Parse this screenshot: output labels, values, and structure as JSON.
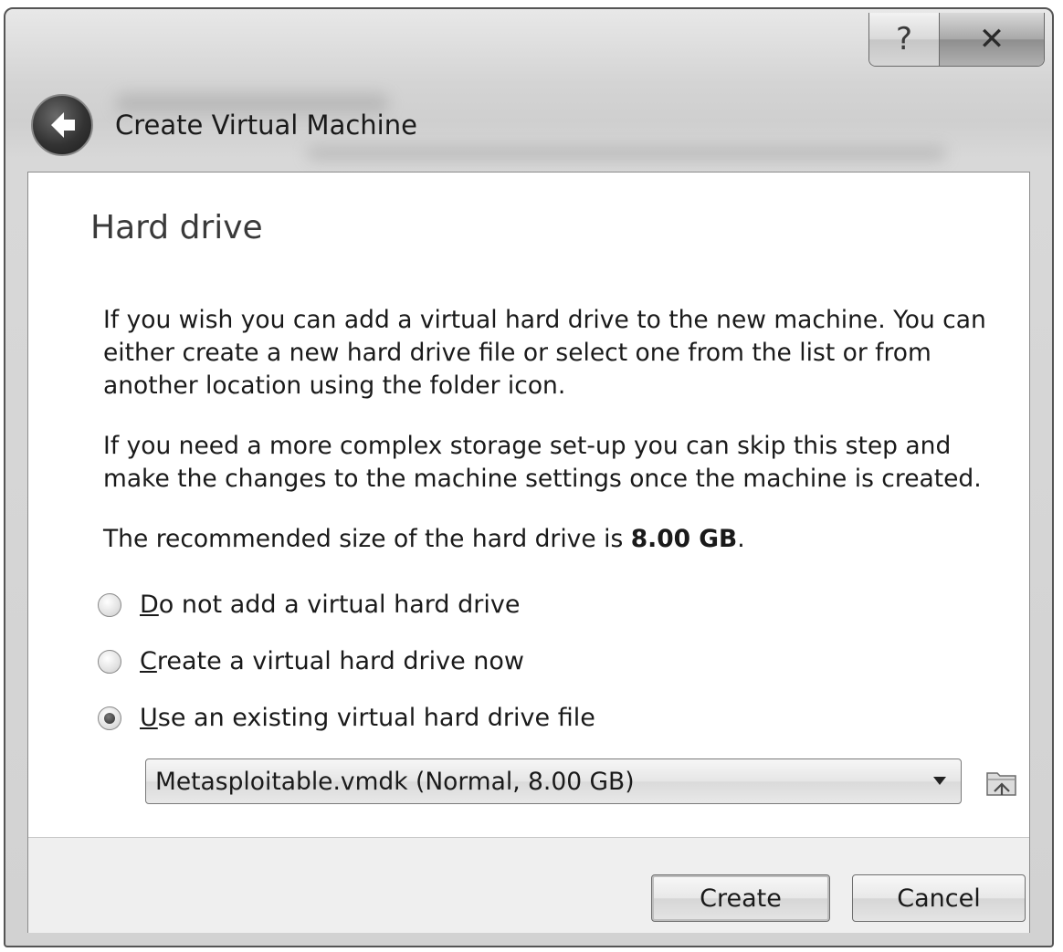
{
  "window": {
    "title": "Create Virtual Machine",
    "help_glyph": "?",
    "close_glyph": "✕"
  },
  "page": {
    "heading": "Hard drive",
    "paragraph1": "If you wish you can add a virtual hard drive to the new machine. You can either create a new hard drive file or select one from the list or from another location using the folder icon.",
    "paragraph2": "If you need a more complex storage set-up you can skip this step and make the changes to the machine settings once the machine is created.",
    "recommended_prefix": "The recommended size of the hard drive is ",
    "recommended_size": "8.00 GB",
    "recommended_suffix": "."
  },
  "options": [
    {
      "mnemonic": "D",
      "rest": "o not add a virtual hard drive",
      "selected": false
    },
    {
      "mnemonic": "C",
      "rest": "reate a virtual hard drive now",
      "selected": false
    },
    {
      "mnemonic": "U",
      "rest": "se an existing virtual hard drive file",
      "selected": true
    }
  ],
  "disk_select": {
    "value": "Metasploitable.vmdk (Normal, 8.00 GB)",
    "folder_icon": "folder-icon"
  },
  "buttons": {
    "create": "Create",
    "cancel": "Cancel"
  }
}
